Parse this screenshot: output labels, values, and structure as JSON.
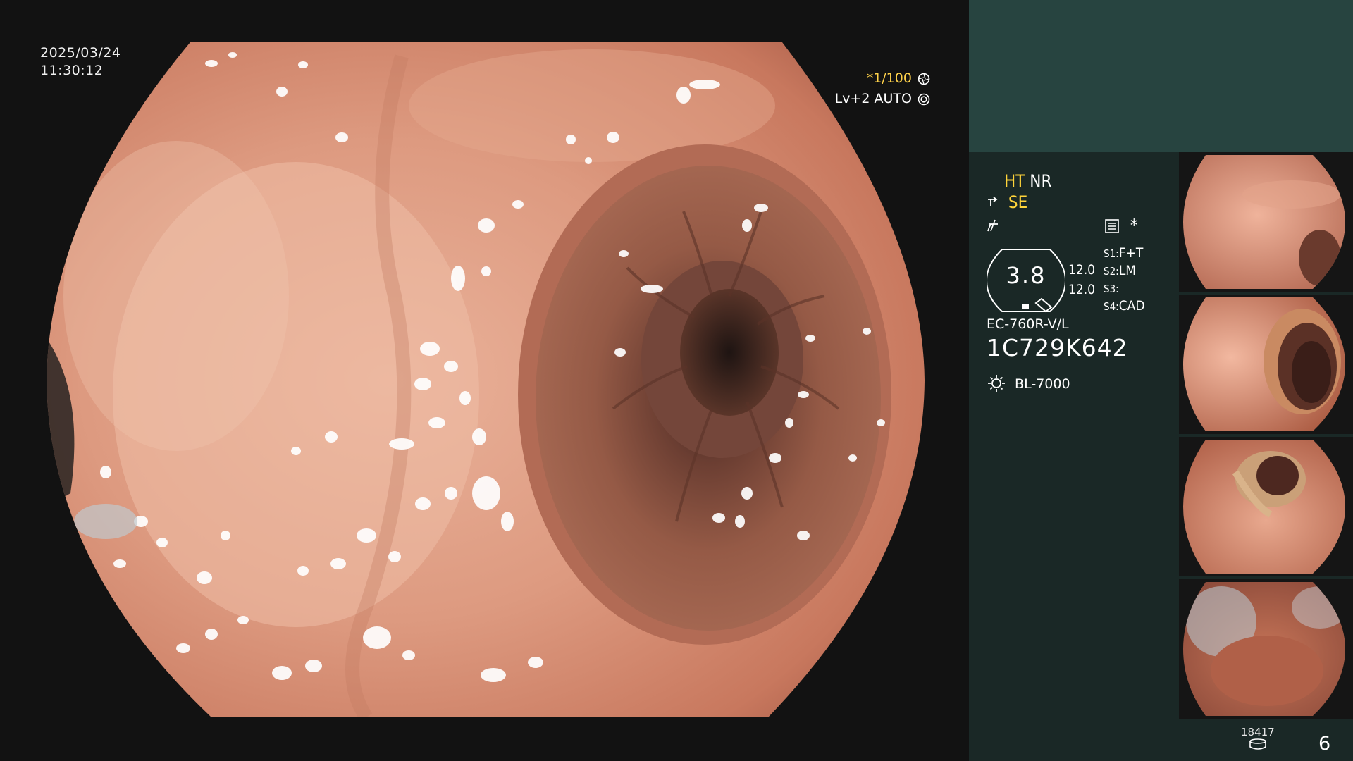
{
  "overlay": {
    "date": "2025/03/24",
    "time": "11:30:12",
    "shutter": "*1/100",
    "level": "Lv+2",
    "iris_mode": "AUTO"
  },
  "settings": {
    "ht": "HT",
    "nr": "NR",
    "se": "SE",
    "mode_star": "*",
    "gauge_value": "3.8",
    "value_1": "12.0",
    "value_2": "12.0",
    "s1_label": "S1:",
    "s1_value": "F+T",
    "s2_label": "S2:",
    "s2_value": "LM",
    "s3_label": "S3:",
    "s4_label": "S4:",
    "s4_value": "CAD",
    "scope_model": "EC-760R-V/L",
    "scope_serial": "1C729K642",
    "light_source": "BL-7000"
  },
  "footer": {
    "image_counter": "18417",
    "capture_index": "6"
  },
  "icons": {
    "shutter": "aperture-icon",
    "iris": "iris-icon",
    "se_mark": "scope-tip-icon",
    "enhance": "curve-icon",
    "menu": "menu-icon",
    "light": "light-bulb-icon",
    "storage": "storage-icon"
  },
  "colors": {
    "highlight": "#ffd43a",
    "panel_top": "#274440",
    "panel": "#1a2826",
    "mucosa": "#d68a70"
  }
}
